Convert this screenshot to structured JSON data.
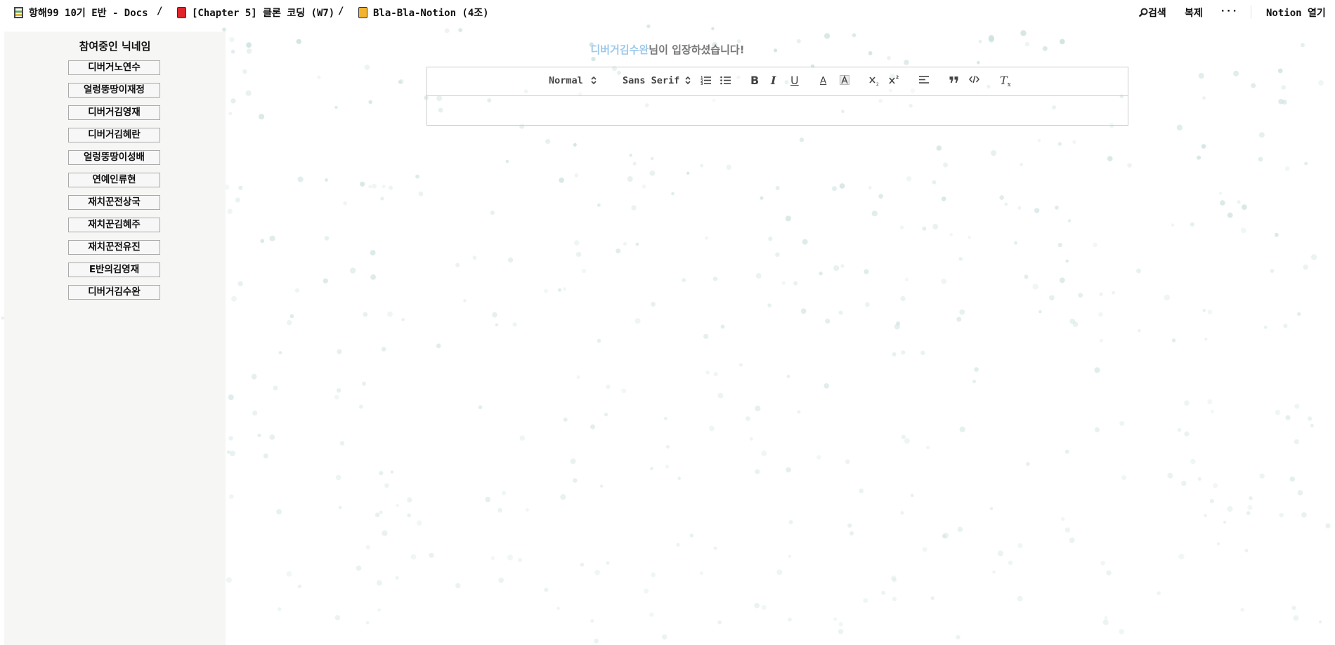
{
  "breadcrumbs": [
    {
      "label": "항해99 10기 E반 - Docs",
      "icon": "database-icon"
    },
    {
      "label": "[Chapter 5] 클론 코딩 (W7)",
      "icon": "red-book-icon"
    },
    {
      "label": "Bla-Bla-Notion (4조)",
      "icon": "yellow-book-icon"
    }
  ],
  "breadcrumb_separator": "/",
  "topbar": {
    "search_label": "검색",
    "duplicate_label": "복제",
    "more_label": "···",
    "open_notion_label": "Notion 열기"
  },
  "sidebar": {
    "title": "참여중인 닉네임",
    "nicknames": [
      "디버거노연수",
      "얼렁뚱땅이재정",
      "디버거김영재",
      "디버거김혜란",
      "얼렁뚱땅이성배",
      "연예인류현",
      "재치꾼전상국",
      "재치꾼김혜주",
      "재치꾼전유진",
      "E반의김영재",
      "디버거김수완"
    ]
  },
  "notice": {
    "name": "디버거김수완",
    "message": "님이 입장하셨습니다!"
  },
  "toolbar": {
    "heading_select": "Normal",
    "font_select": "Sans Serif",
    "bold": "B",
    "italic": "I",
    "underline": "U",
    "text_color": "A",
    "clear_format": "T"
  },
  "colors": {
    "notice_name": "#9cc9ea",
    "notice_text": "#777777",
    "sidebar_bg": "#f6f6f4",
    "snow": "#c9dfdd"
  }
}
